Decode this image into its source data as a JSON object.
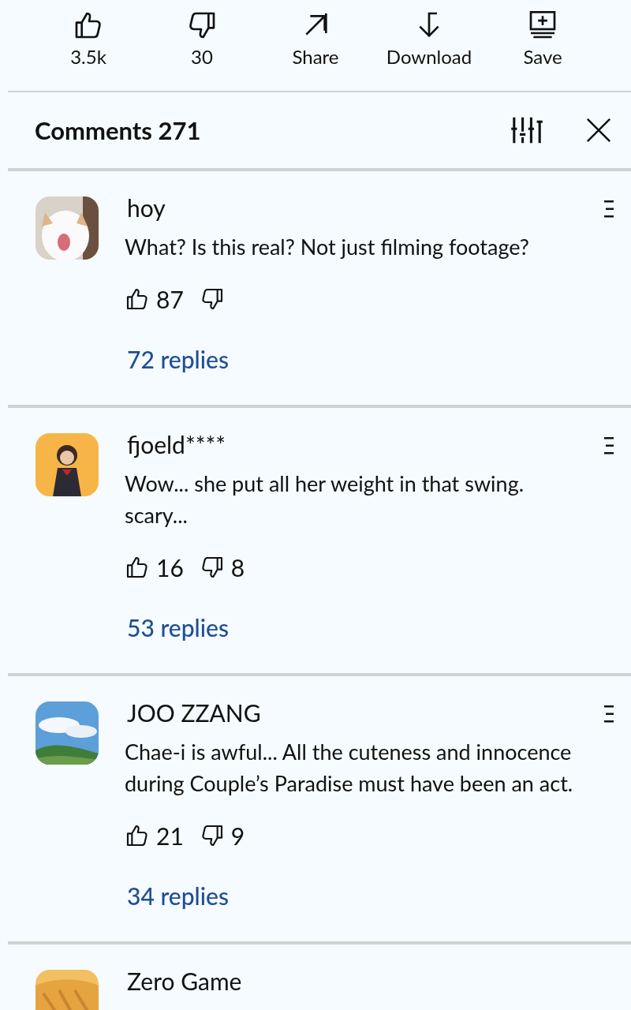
{
  "actions": [
    {
      "kind": "like",
      "label": "3.5k"
    },
    {
      "kind": "dislike",
      "label": "30"
    },
    {
      "kind": "share",
      "label": "Share"
    },
    {
      "kind": "download",
      "label": "Download"
    },
    {
      "kind": "save",
      "label": "Save"
    }
  ],
  "header": {
    "title": "Comments 271"
  },
  "comments": [
    {
      "name": "hoy",
      "text": "What? Is this real? Not just filming footage?",
      "likes": "87",
      "replies": "72 replies"
    },
    {
      "name": "fjoeld****",
      "text": "Wow... she put all her weight in that swing. scary...",
      "likes": "16",
      "dislikes": "8",
      "replies": "53 replies"
    },
    {
      "name": "JOO ZZANG",
      "text": "Chae-i is awful... All the cuteness and innocence during Couple’s Paradise must have been an act.",
      "likes": "21",
      "dislikes": "9",
      "replies": "34 replies"
    },
    {
      "name": "Zero Game"
    }
  ]
}
